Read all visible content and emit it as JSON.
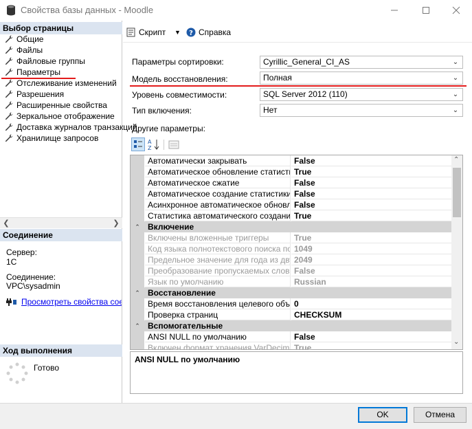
{
  "window": {
    "title": "Свойства базы данных - Moodle",
    "controls": [
      "minimize",
      "maximize",
      "close"
    ]
  },
  "left_pane": {
    "select_page_header": "Выбор страницы",
    "pages": [
      {
        "label": "Общие",
        "icon": "wrench-icon",
        "selected": false
      },
      {
        "label": "Файлы",
        "icon": "wrench-icon",
        "selected": false
      },
      {
        "label": "Файловые группы",
        "icon": "wrench-icon",
        "selected": false
      },
      {
        "label": "Параметры",
        "icon": "wrench-icon",
        "selected": true
      },
      {
        "label": "Отслеживание изменений",
        "icon": "wrench-icon",
        "selected": false
      },
      {
        "label": "Разрешения",
        "icon": "wrench-icon",
        "selected": false
      },
      {
        "label": "Расширенные свойства",
        "icon": "wrench-icon",
        "selected": false
      },
      {
        "label": "Зеркальное отображение",
        "icon": "wrench-icon",
        "selected": false
      },
      {
        "label": "Доставка журналов транзакций",
        "icon": "wrench-icon",
        "selected": false
      },
      {
        "label": "Хранилище запросов",
        "icon": "wrench-icon",
        "selected": false
      }
    ],
    "connection_header": "Соединение",
    "server_label": "Сервер:",
    "server_value": "1С",
    "connection_label": "Соединение:",
    "connection_value": "VPC\\sysadmin",
    "view_connection_link": "Просмотреть свойства соединения",
    "progress_header": "Ход выполнения",
    "progress_status": "Готово"
  },
  "toolbar": {
    "script_label": "Скрипт",
    "help_label": "Справка"
  },
  "options": {
    "collation_label": "Параметры сортировки:",
    "collation_value": "Cyrillic_General_CI_AS",
    "recovery_label": "Модель восстановления:",
    "recovery_value": "Полная",
    "compat_label": "Уровень совместимости:",
    "compat_value": "SQL Server 2012 (110)",
    "containment_label": "Тип включения:",
    "containment_value": "Нет",
    "other_label": "Другие параметры:"
  },
  "grid": {
    "rows": [
      {
        "type": "prop",
        "name": "Автоматически закрывать",
        "value": "False",
        "disabled": false
      },
      {
        "type": "prop",
        "name": "Автоматическое обновление статистики",
        "value": "True",
        "disabled": false
      },
      {
        "type": "prop",
        "name": "Автоматическое сжатие",
        "value": "False",
        "disabled": false
      },
      {
        "type": "prop",
        "name": "Автоматическое создание статистики с добавочным",
        "value": "False",
        "disabled": false
      },
      {
        "type": "prop",
        "name": "Асинхронное автоматическое обновление статистики",
        "value": "False",
        "disabled": false
      },
      {
        "type": "prop",
        "name": "Статистика автоматического создания",
        "value": "True",
        "disabled": false
      },
      {
        "type": "cat",
        "name": "Включение"
      },
      {
        "type": "prop",
        "name": "Включены вложенные триггеры",
        "value": "True",
        "disabled": true
      },
      {
        "type": "prop",
        "name": "Код языка полнотекстового поиска по умолчанию",
        "value": "1049",
        "disabled": true
      },
      {
        "type": "prop",
        "name": "Предельное значение для года из двух цифр",
        "value": "2049",
        "disabled": true
      },
      {
        "type": "prop",
        "name": "Преобразование пропускаемых слов",
        "value": "False",
        "disabled": true
      },
      {
        "type": "prop",
        "name": "Язык по умолчанию",
        "value": "Russian",
        "disabled": true
      },
      {
        "type": "cat",
        "name": "Восстановление"
      },
      {
        "type": "prop",
        "name": "Время восстановления целевого объекта (сек)",
        "value": "0",
        "disabled": false
      },
      {
        "type": "prop",
        "name": "Проверка страниц",
        "value": "CHECKSUM",
        "disabled": false
      },
      {
        "type": "cat",
        "name": "Вспомогательные"
      },
      {
        "type": "prop",
        "name": "ANSI NULL по умолчанию",
        "value": "False",
        "disabled": false
      },
      {
        "type": "prop",
        "name": "Включен формат хранения VarDecimal",
        "value": "True",
        "disabled": true
      }
    ]
  },
  "description": "ANSI NULL по умолчанию",
  "buttons": {
    "ok": "OK",
    "cancel": "Отмена"
  },
  "colors": {
    "annotation_red": "#e31b1b",
    "section_header_bg": "#dbe4f0",
    "link_blue": "#0000ee"
  }
}
